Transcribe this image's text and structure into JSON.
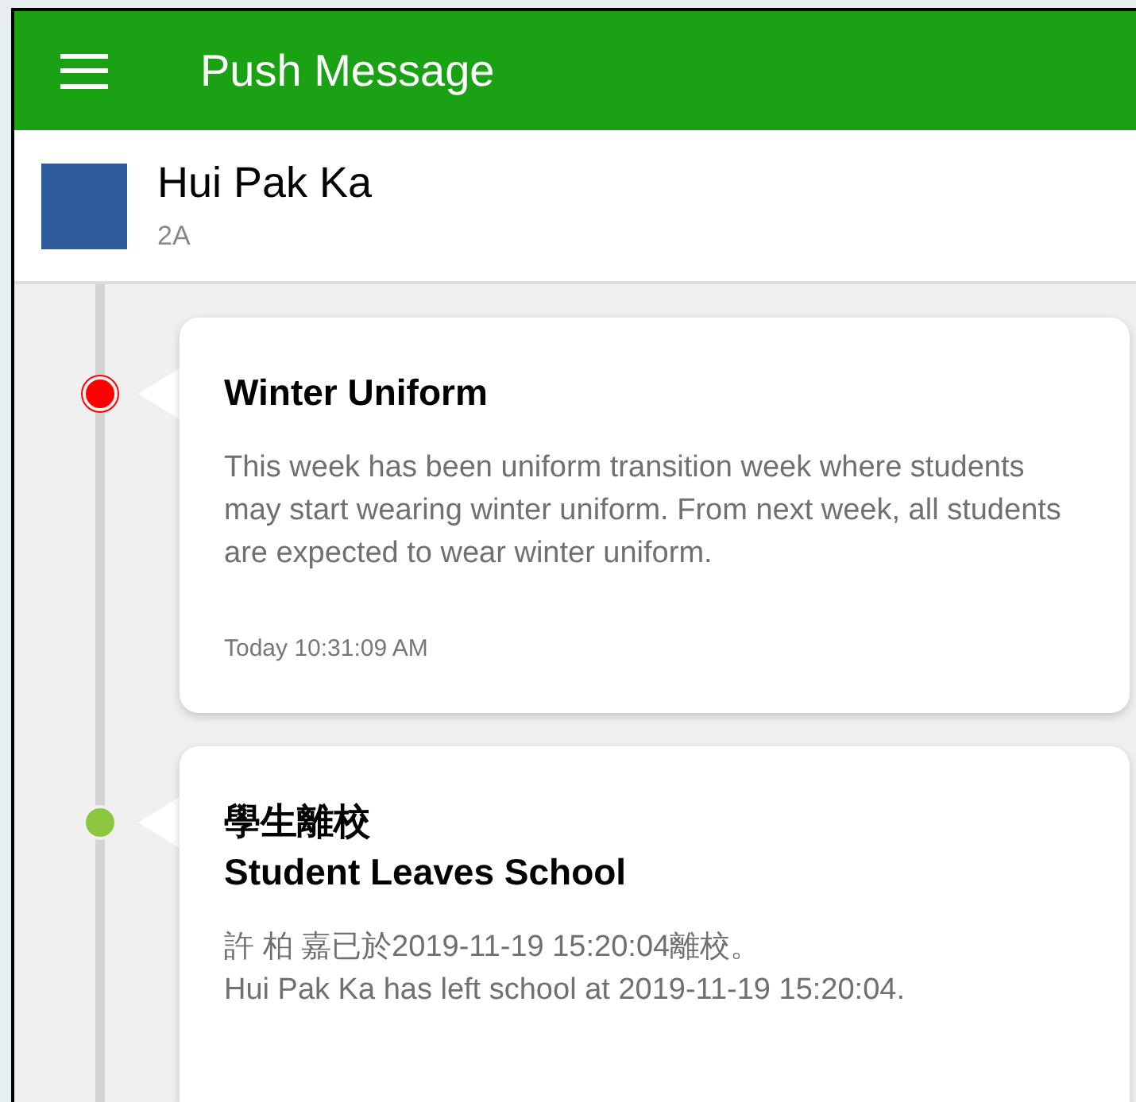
{
  "app_bar": {
    "title": "Push Message"
  },
  "student": {
    "name": "Hui Pak Ka",
    "class": "2A"
  },
  "messages": [
    {
      "color": "#ff0000",
      "title_lines": [
        "Winter Uniform"
      ],
      "body_lines": [
        "This week has been uniform transition week where students may start wearing winter uniform. From next week, all students are expected to wear winter uniform."
      ],
      "time": "Today 10:31:09 AM"
    },
    {
      "color": "#8dc63f",
      "title_lines": [
        "學生離校",
        "Student Leaves School"
      ],
      "body_lines": [
        "許 柏 嘉已於2019-11-19 15:20:04離校。",
        "Hui Pak Ka has left school at 2019-11-19 15:20:04."
      ]
    }
  ]
}
